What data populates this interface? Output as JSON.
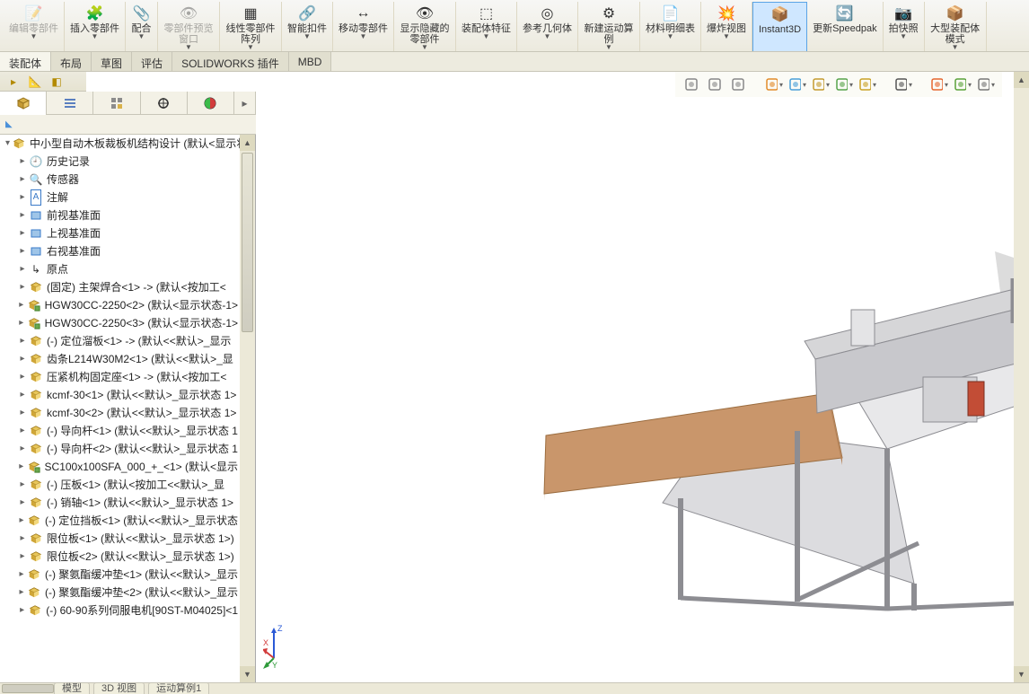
{
  "ribbon": {
    "items": [
      {
        "icon": "📝",
        "label": "编辑零部件",
        "gray": true
      },
      {
        "icon": "🧩",
        "label": "插入零部件"
      },
      {
        "icon": "📎",
        "label": "配合"
      },
      {
        "icon": "👁",
        "label": "零部件预览窗口",
        "gray": true
      },
      {
        "icon": "▦",
        "label": "线性零部件阵列"
      },
      {
        "icon": "🔗",
        "label": "智能扣件"
      },
      {
        "icon": "↔",
        "label": "移动零部件"
      },
      {
        "icon": "👁",
        "label": "显示隐藏的零部件"
      },
      {
        "icon": "⬚",
        "label": "装配体特征"
      },
      {
        "icon": "◎",
        "label": "参考几何体"
      },
      {
        "icon": "⚙",
        "label": "新建运动算例"
      },
      {
        "icon": "📄",
        "label": "材料明细表"
      },
      {
        "icon": "💥",
        "label": "爆炸视图"
      },
      {
        "icon": "📦",
        "label": "Instant3D",
        "active": true,
        "single": true
      },
      {
        "icon": "🔄",
        "label": "更新Speedpak",
        "single": true
      },
      {
        "icon": "📷",
        "label": "拍快照"
      },
      {
        "icon": "📦",
        "label": "大型装配体模式"
      }
    ]
  },
  "cmd_tabs": [
    "装配体",
    "布局",
    "草图",
    "评估",
    "SOLIDWORKS 插件",
    "MBD"
  ],
  "cmd_tabs_active": 0,
  "viewport_buttons": [
    {
      "name": "zoom-fit-icon",
      "color": "#888"
    },
    {
      "name": "zoom-area-icon",
      "color": "#888"
    },
    {
      "name": "zoom-prev-icon",
      "color": "#888"
    },
    {
      "name": "section-icon",
      "color": "#e28b2a"
    },
    {
      "name": "orient-icon",
      "color": "#4aa0d8"
    },
    {
      "name": "display-icon",
      "color": "#c49b2e"
    },
    {
      "name": "scene-icon",
      "color": "#56a34a"
    },
    {
      "name": "view-cube-icon",
      "color": "#c9a227"
    },
    {
      "name": "eye-icon",
      "color": "#555"
    },
    {
      "name": "appearance-icon",
      "color": "#e6662e"
    },
    {
      "name": "decal-icon",
      "color": "#5aa23a"
    },
    {
      "name": "screen-icon",
      "color": "#777"
    }
  ],
  "feature_tabs": [
    {
      "name": "cube-tab-icon",
      "active": true
    },
    {
      "name": "list-tab-icon"
    },
    {
      "name": "config-tab-icon"
    },
    {
      "name": "dim-tab-icon"
    },
    {
      "name": "appearance-tab-icon"
    }
  ],
  "filter_label": "",
  "assembly_root": "中小型自动木板裁板机结构设计  (默认<显示状",
  "tree": [
    {
      "type": "asm",
      "label": "中小型自动木板裁板机结构设计  (默认<显示状",
      "level": 1,
      "expander": "▾",
      "icon": "asm"
    },
    {
      "type": "folder",
      "label": "历史记录",
      "level": 2,
      "icon": "hist"
    },
    {
      "type": "folder",
      "label": "传感器",
      "level": 2,
      "icon": "sensor"
    },
    {
      "type": "folder",
      "label": "注解",
      "level": 2,
      "icon": "annot"
    },
    {
      "type": "plane",
      "label": "前视基准面",
      "level": 2,
      "icon": "plane"
    },
    {
      "type": "plane",
      "label": "上视基准面",
      "level": 2,
      "icon": "plane"
    },
    {
      "type": "plane",
      "label": "右视基准面",
      "level": 2,
      "icon": "plane"
    },
    {
      "type": "origin",
      "label": "原点",
      "level": 2,
      "icon": "origin"
    },
    {
      "type": "part",
      "label": "(固定) 主架焊合<1> -> (默认<按加工<",
      "level": 2,
      "icon": "part"
    },
    {
      "type": "part",
      "label": "HGW30CC-2250<2> (默认<显示状态-1>",
      "level": 2,
      "icon": "sub"
    },
    {
      "type": "part",
      "label": "HGW30CC-2250<3> (默认<显示状态-1>",
      "level": 2,
      "icon": "sub"
    },
    {
      "type": "part",
      "label": "(-) 定位溜板<1> -> (默认<<默认>_显示",
      "level": 2,
      "icon": "part"
    },
    {
      "type": "part",
      "label": "齿条L214W30M2<1> (默认<<默认>_显",
      "level": 2,
      "icon": "part"
    },
    {
      "type": "part",
      "label": "压紧机构固定座<1> -> (默认<按加工<",
      "level": 2,
      "icon": "part"
    },
    {
      "type": "part",
      "label": "kcmf-30<1> (默认<<默认>_显示状态 1>",
      "level": 2,
      "icon": "part"
    },
    {
      "type": "part",
      "label": "kcmf-30<2> (默认<<默认>_显示状态 1>",
      "level": 2,
      "icon": "part"
    },
    {
      "type": "part",
      "label": "(-) 导向杆<1> (默认<<默认>_显示状态 1",
      "level": 2,
      "icon": "part"
    },
    {
      "type": "part",
      "label": "(-) 导向杆<2> (默认<<默认>_显示状态 1",
      "level": 2,
      "icon": "part"
    },
    {
      "type": "part",
      "label": "SC100x100SFA_000_+_<1> (默认<显示",
      "level": 2,
      "icon": "sub"
    },
    {
      "type": "part",
      "label": "(-) 压板<1> (默认<按加工<<默认>_显",
      "level": 2,
      "icon": "part"
    },
    {
      "type": "part",
      "label": "(-) 销轴<1> (默认<<默认>_显示状态 1>",
      "level": 2,
      "icon": "part"
    },
    {
      "type": "part",
      "label": "(-) 定位挡板<1> (默认<<默认>_显示状态",
      "level": 2,
      "icon": "part"
    },
    {
      "type": "part",
      "label": "限位板<1> (默认<<默认>_显示状态 1>)",
      "level": 2,
      "icon": "part"
    },
    {
      "type": "part",
      "label": "限位板<2> (默认<<默认>_显示状态 1>)",
      "level": 2,
      "icon": "part"
    },
    {
      "type": "part",
      "label": "(-) 聚氨酯缓冲垫<1> (默认<<默认>_显示",
      "level": 2,
      "icon": "part"
    },
    {
      "type": "part",
      "label": "(-) 聚氨酯缓冲垫<2> (默认<<默认>_显示",
      "level": 2,
      "icon": "part"
    },
    {
      "type": "part",
      "label": "(-) 60-90系列伺服电机[90ST-M04025]<1",
      "level": 2,
      "icon": "part"
    }
  ],
  "bottom_tabs": [
    "模型",
    "3D 视图",
    "运动算例1"
  ],
  "triad_labels": {
    "x": "X",
    "y": "Y",
    "z": "Z"
  }
}
